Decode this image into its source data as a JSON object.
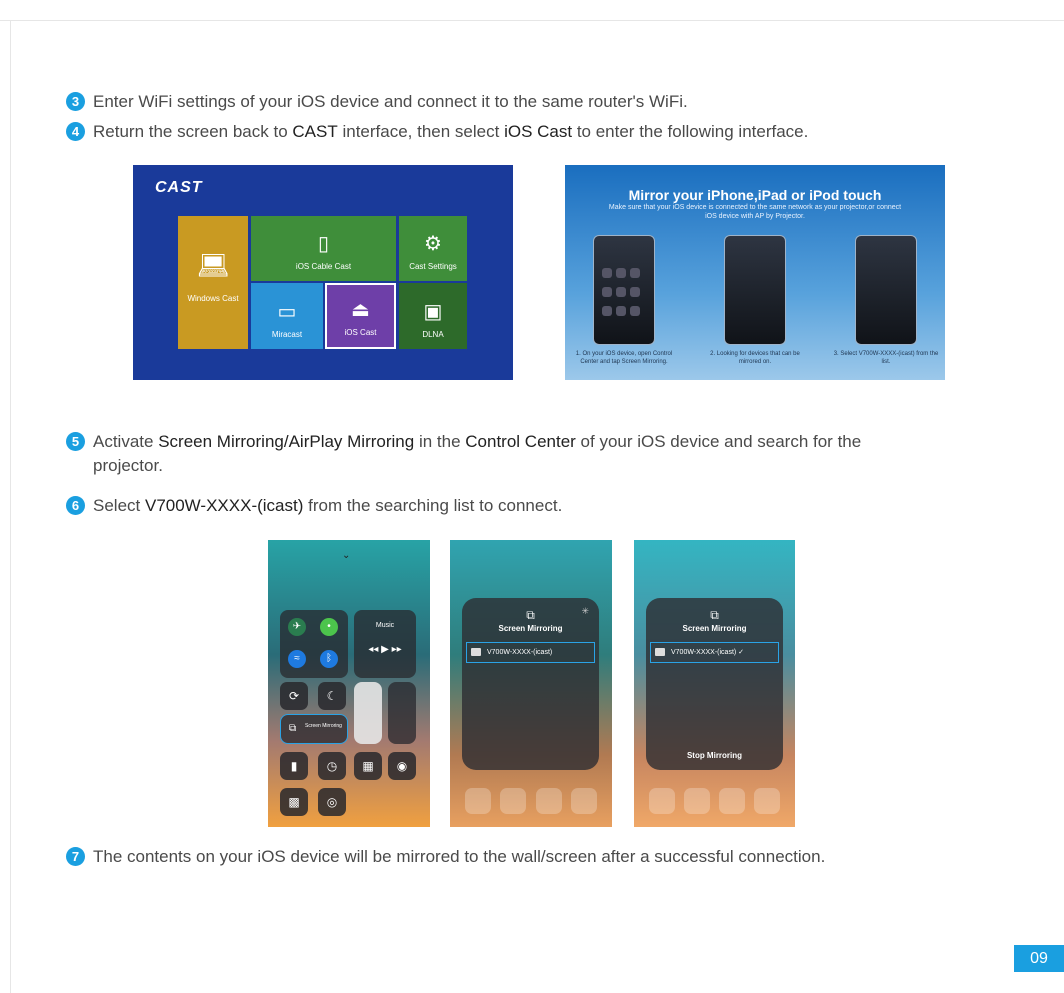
{
  "steps": {
    "s3": {
      "num": "3",
      "text": "Enter WiFi settings of your iOS device and connect it to the same router's WiFi."
    },
    "s4": {
      "num": "4",
      "pre": "Return the screen back to ",
      "b1": "CAST",
      "mid": " interface, then select ",
      "b2": "iOS Cast",
      "post": " to enter the following interface."
    },
    "s5": {
      "num": "5",
      "pre": "Activate ",
      "b1": "Screen Mirroring/AirPlay Mirroring",
      "mid": " in the ",
      "b2": "Control Center",
      "post": " of your iOS device and search for the",
      "line2": "projector."
    },
    "s6": {
      "num": "6",
      "pre": "Select ",
      "b1": "V700W-XXXX-(icast)",
      "post": " from the searching list to connect."
    },
    "s7": {
      "num": "7",
      "text": "The contents on your iOS device will be mirrored to the wall/screen after a successful connection."
    }
  },
  "cast_ui": {
    "title": "CAST",
    "tiles": {
      "windows": "Windows Cast",
      "cable": "iOS Cable Cast",
      "settings": "Cast Settings",
      "miracast": "Miracast",
      "ioscast": "iOS Cast",
      "dlna": "DLNA"
    }
  },
  "mirror_ui": {
    "title": "Mirror your iPhone,iPad or iPod touch",
    "subtitle": "Make sure that your iOS device is connected to the same network as your projector,or connect iOS device with AP by Projector.",
    "captions": [
      "1. On your iOS device, open Control Center and tap Screen Mirroring.",
      "2. Looking for devices that can be mirrored on.",
      "3. Select V700W-XXXX-(icast) from the list."
    ]
  },
  "phones": {
    "cc": {
      "music": "Music",
      "screen_mirroring": "Screen Mirroring"
    },
    "panel": {
      "title": "Screen Mirroring",
      "device": "V700W-XXXX-(icast)",
      "device_checked": "V700W-XXXX-(icast) ✓",
      "stop": "Stop Mirroring"
    }
  },
  "page_number": "09",
  "colors": {
    "accent": "#1a9fe0"
  }
}
